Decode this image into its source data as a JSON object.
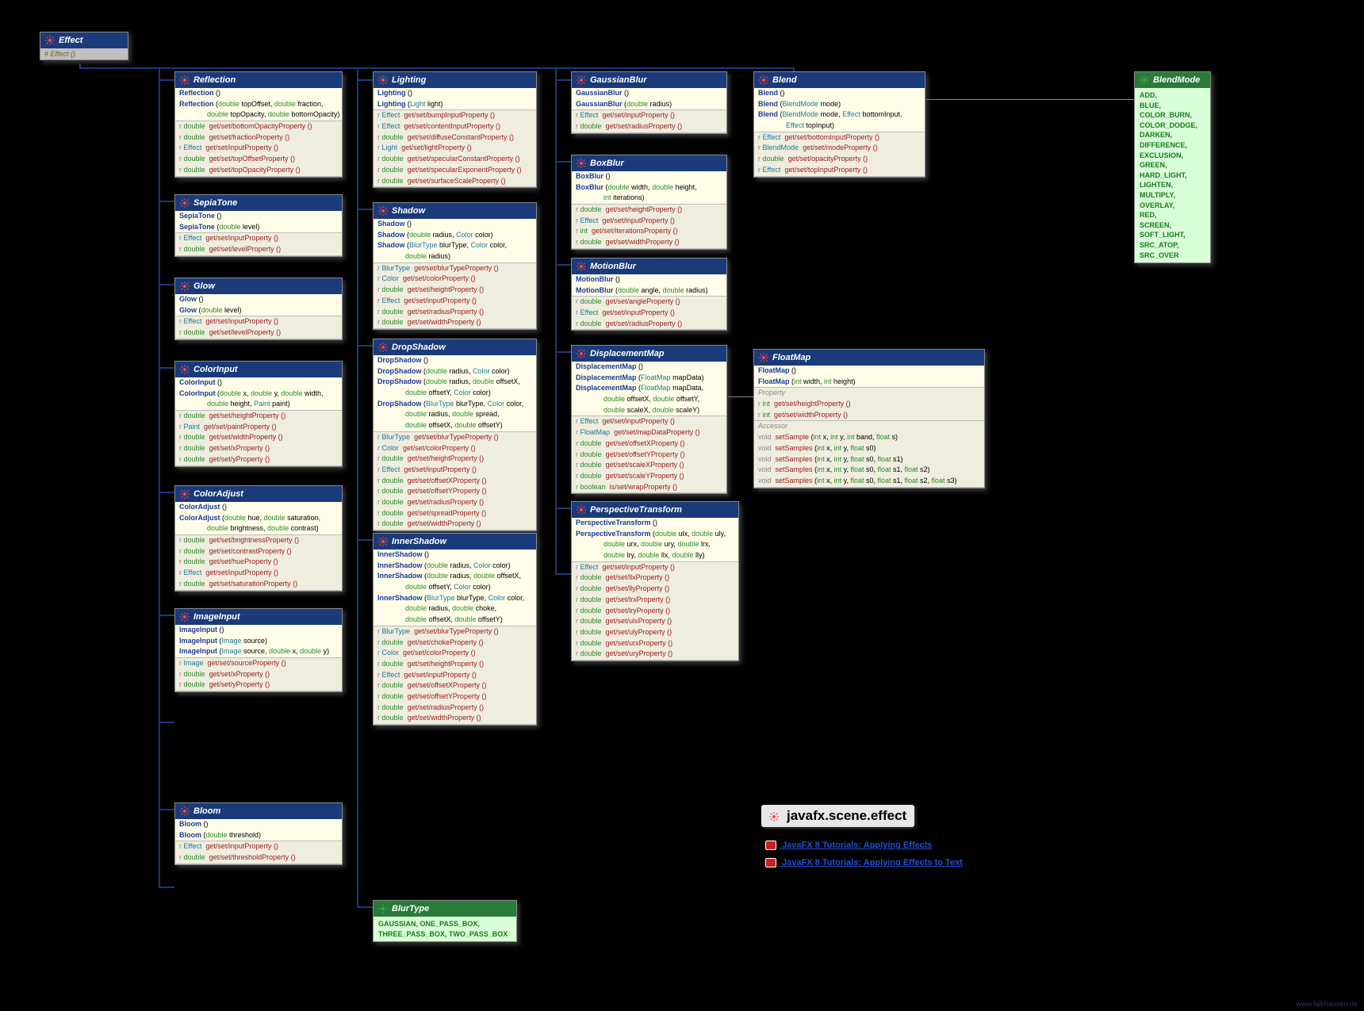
{
  "package_title": "javafx.scene.effect",
  "links": [
    "JavaFX 8 Tutorials: Applying Effects",
    "JavaFX 8 Tutorials: Applying Effects to Text"
  ],
  "watermark": "www.falkhausen.de",
  "root": {
    "title": "Effect",
    "sub": "# Effect ()"
  },
  "blendmode": {
    "title": "BlendMode",
    "items": [
      "ADD,",
      "BLUE,",
      "COLOR_BURN,",
      "COLOR_DODGE,",
      "DARKEN,",
      "DIFFERENCE,",
      "EXCLUSION,",
      "GREEN,",
      "HARD_LIGHT,",
      "LIGHTEN,",
      "MULTIPLY,",
      "OVERLAY,",
      "RED,",
      "SCREEN,",
      "SOFT_LIGHT,",
      "SRC_ATOP,",
      "SRC_OVER"
    ]
  },
  "blurtype": {
    "title": "BlurType",
    "line1": "GAUSSIAN, ONE_PASS_BOX,",
    "line2": "THREE_PASS_BOX, TWO_PASS_BOX"
  },
  "classes": {
    "reflection": {
      "title": "Reflection",
      "ctors": [
        {
          "name": "Reflection",
          "args": "()"
        },
        {
          "name": "Reflection",
          "args": "(double topOffset, double fraction,",
          "cont": "double topOpacity, double bottomOpacity)"
        }
      ],
      "props": [
        {
          "ret": "double",
          "m": "get/set/bottomOpacityProperty ()"
        },
        {
          "ret": "double",
          "m": "get/set/fractionProperty ()"
        },
        {
          "ret": "Effect",
          "m": "get/set/inputProperty ()"
        },
        {
          "ret": "double",
          "m": "get/set/topOffsetProperty ()"
        },
        {
          "ret": "double",
          "m": "get/set/topOpacityProperty ()"
        }
      ]
    },
    "sepiatone": {
      "title": "SepiaTone",
      "ctors": [
        {
          "name": "SepiaTone",
          "args": "()"
        },
        {
          "name": "SepiaTone",
          "args": "(double level)"
        }
      ],
      "props": [
        {
          "ret": "Effect",
          "m": "get/set/inputProperty ()"
        },
        {
          "ret": "double",
          "m": "get/set/levelProperty ()"
        }
      ]
    },
    "glow": {
      "title": "Glow",
      "ctors": [
        {
          "name": "Glow",
          "args": "()"
        },
        {
          "name": "Glow",
          "args": "(double level)"
        }
      ],
      "props": [
        {
          "ret": "Effect",
          "m": "get/set/inputProperty ()"
        },
        {
          "ret": "double",
          "m": "get/set/levelProperty ()"
        }
      ]
    },
    "colorinput": {
      "title": "ColorInput",
      "ctors": [
        {
          "name": "ColorInput",
          "args": "()"
        },
        {
          "name": "ColorInput",
          "args": "(double x, double y, double width,",
          "cont": "double height, Paint paint)"
        }
      ],
      "props": [
        {
          "ret": "double",
          "m": "get/set/heightProperty ()"
        },
        {
          "ret": "Paint",
          "m": "get/set/paintProperty ()"
        },
        {
          "ret": "double",
          "m": "get/set/widthProperty ()"
        },
        {
          "ret": "double",
          "m": "get/set/xProperty ()"
        },
        {
          "ret": "double",
          "m": "get/set/yProperty ()"
        }
      ]
    },
    "coloradjust": {
      "title": "ColorAdjust",
      "ctors": [
        {
          "name": "ColorAdjust",
          "args": "()"
        },
        {
          "name": "ColorAdjust",
          "args": "(double hue, double saturation,",
          "cont": "double brightness, double contrast)"
        }
      ],
      "props": [
        {
          "ret": "double",
          "m": "get/set/brightnessProperty ()"
        },
        {
          "ret": "double",
          "m": "get/set/contrastProperty ()"
        },
        {
          "ret": "double",
          "m": "get/set/hueProperty ()"
        },
        {
          "ret": "Effect",
          "m": "get/set/inputProperty ()"
        },
        {
          "ret": "double",
          "m": "get/set/saturationProperty ()"
        }
      ]
    },
    "imageinput": {
      "title": "ImageInput",
      "ctors": [
        {
          "name": "ImageInput",
          "args": "()"
        },
        {
          "name": "ImageInput",
          "args": "(Image source)"
        },
        {
          "name": "ImageInput",
          "args": "(Image source, double x, double y)"
        }
      ],
      "props": [
        {
          "ret": "Image",
          "m": "get/set/sourceProperty ()"
        },
        {
          "ret": "double",
          "m": "get/set/xProperty ()"
        },
        {
          "ret": "double",
          "m": "get/set/yProperty ()"
        }
      ]
    },
    "bloom": {
      "title": "Bloom",
      "ctors": [
        {
          "name": "Bloom",
          "args": "()"
        },
        {
          "name": "Bloom",
          "args": "(double threshold)"
        }
      ],
      "props": [
        {
          "ret": "Effect",
          "m": "get/set/inputProperty ()"
        },
        {
          "ret": "double",
          "m": "get/set/thresholdProperty ()"
        }
      ]
    },
    "lighting": {
      "title": "Lighting",
      "ctors": [
        {
          "name": "Lighting",
          "args": "()"
        },
        {
          "name": "Lighting",
          "args": "(Light light)"
        }
      ],
      "props": [
        {
          "ret": "Effect",
          "m": "get/set/bumpInputProperty ()"
        },
        {
          "ret": "Effect",
          "m": "get/set/contentInputProperty ()"
        },
        {
          "ret": "double",
          "m": "get/set/diffuseConstantProperty ()"
        },
        {
          "ret": "Light",
          "m": "get/set/lightProperty ()"
        },
        {
          "ret": "double",
          "m": "get/set/specularConstantProperty ()"
        },
        {
          "ret": "double",
          "m": "get/set/specularExponentProperty ()"
        },
        {
          "ret": "double",
          "m": "get/set/surfaceScaleProperty ()"
        }
      ]
    },
    "shadow": {
      "title": "Shadow",
      "ctors": [
        {
          "name": "Shadow",
          "args": "()"
        },
        {
          "name": "Shadow",
          "args": "(double radius, Color color)"
        },
        {
          "name": "Shadow",
          "args": "(BlurType blurType, Color color,",
          "cont": "double radius)"
        }
      ],
      "props": [
        {
          "ret": "BlurType",
          "m": "get/set/blurTypeProperty ()"
        },
        {
          "ret": "Color",
          "m": "get/set/colorProperty ()"
        },
        {
          "ret": "double",
          "m": "get/set/heightProperty ()"
        },
        {
          "ret": "Effect",
          "m": "get/set/inputProperty ()"
        },
        {
          "ret": "double",
          "m": "get/set/radiusProperty ()"
        },
        {
          "ret": "double",
          "m": "get/set/widthProperty ()"
        }
      ]
    },
    "dropshadow": {
      "title": "DropShadow",
      "ctors": [
        {
          "name": "DropShadow",
          "args": "()"
        },
        {
          "name": "DropShadow",
          "args": "(double radius, Color color)"
        },
        {
          "name": "DropShadow",
          "args": "(double radius, double offsetX,",
          "cont": "double offsetY, Color color)"
        },
        {
          "name": "DropShadow",
          "args": "(BlurType blurType, Color color,",
          "cont": "double radius, double spread,",
          "cont2": "double offsetX, double offsetY)"
        }
      ],
      "props": [
        {
          "ret": "BlurType",
          "m": "get/set/blurTypeProperty ()"
        },
        {
          "ret": "Color",
          "m": "get/set/colorProperty ()"
        },
        {
          "ret": "double",
          "m": "get/set/heightProperty ()"
        },
        {
          "ret": "Effect",
          "m": "get/set/inputProperty ()"
        },
        {
          "ret": "double",
          "m": "get/set/offsetXProperty ()"
        },
        {
          "ret": "double",
          "m": "get/set/offsetYProperty ()"
        },
        {
          "ret": "double",
          "m": "get/set/radiusProperty ()"
        },
        {
          "ret": "double",
          "m": "get/set/spreadProperty ()"
        },
        {
          "ret": "double",
          "m": "get/set/widthProperty ()"
        }
      ]
    },
    "innershadow": {
      "title": "InnerShadow",
      "ctors": [
        {
          "name": "InnerShadow",
          "args": "()"
        },
        {
          "name": "InnerShadow",
          "args": "(double radius, Color color)"
        },
        {
          "name": "InnerShadow",
          "args": "(double radius, double offsetX,",
          "cont": "double offsetY, Color color)"
        },
        {
          "name": "InnerShadow",
          "args": "(BlurType blurType, Color color,",
          "cont": "double radius, double choke,",
          "cont2": "double offsetX, double offsetY)"
        }
      ],
      "props": [
        {
          "ret": "BlurType",
          "m": "get/set/blurTypeProperty ()"
        },
        {
          "ret": "double",
          "m": "get/set/chokeProperty ()"
        },
        {
          "ret": "Color",
          "m": "get/set/colorProperty ()"
        },
        {
          "ret": "double",
          "m": "get/set/heightProperty ()"
        },
        {
          "ret": "Effect",
          "m": "get/set/inputProperty ()"
        },
        {
          "ret": "double",
          "m": "get/set/offsetXProperty ()"
        },
        {
          "ret": "double",
          "m": "get/set/offsetYProperty ()"
        },
        {
          "ret": "double",
          "m": "get/set/radiusProperty ()"
        },
        {
          "ret": "double",
          "m": "get/set/widthProperty ()"
        }
      ]
    },
    "gaussianblur": {
      "title": "GaussianBlur",
      "ctors": [
        {
          "name": "GaussianBlur",
          "args": "()"
        },
        {
          "name": "GaussianBlur",
          "args": "(double radius)"
        }
      ],
      "props": [
        {
          "ret": "Effect",
          "m": "get/set/inputProperty ()"
        },
        {
          "ret": "double",
          "m": "get/set/radiusProperty ()"
        }
      ]
    },
    "boxblur": {
      "title": "BoxBlur",
      "ctors": [
        {
          "name": "BoxBlur",
          "args": "()"
        },
        {
          "name": "BoxBlur",
          "args": "(double width, double height,",
          "cont": "int iterations)"
        }
      ],
      "props": [
        {
          "ret": "double",
          "m": "get/set/heightProperty ()"
        },
        {
          "ret": "Effect",
          "m": "get/set/inputProperty ()"
        },
        {
          "ret": "int",
          "m": "get/set/iterationsProperty ()"
        },
        {
          "ret": "double",
          "m": "get/set/widthProperty ()"
        }
      ]
    },
    "motionblur": {
      "title": "MotionBlur",
      "ctors": [
        {
          "name": "MotionBlur",
          "args": "()"
        },
        {
          "name": "MotionBlur",
          "args": "(double angle, double radius)"
        }
      ],
      "props": [
        {
          "ret": "double",
          "m": "get/set/angleProperty ()"
        },
        {
          "ret": "Effect",
          "m": "get/set/inputProperty ()"
        },
        {
          "ret": "double",
          "m": "get/set/radiusProperty ()"
        }
      ]
    },
    "displacementmap": {
      "title": "DisplacementMap",
      "ctors": [
        {
          "name": "DisplacementMap",
          "args": "()"
        },
        {
          "name": "DisplacementMap",
          "args": "(FloatMap mapData)"
        },
        {
          "name": "DisplacementMap",
          "args": "(FloatMap mapData,",
          "cont": "double offsetX, double offsetY,",
          "cont2": "double scaleX, double scaleY)"
        }
      ],
      "props": [
        {
          "ret": "Effect",
          "m": "get/set/inputProperty ()"
        },
        {
          "ret": "FloatMap",
          "m": "get/set/mapDataProperty ()"
        },
        {
          "ret": "double",
          "m": "get/set/offsetXProperty ()"
        },
        {
          "ret": "double",
          "m": "get/set/offsetYProperty ()"
        },
        {
          "ret": "double",
          "m": "get/set/scaleXProperty ()"
        },
        {
          "ret": "double",
          "m": "get/set/scaleYProperty ()"
        },
        {
          "ret": "boolean",
          "m": "is/set/wrapProperty ()"
        }
      ]
    },
    "perspectivetransform": {
      "title": "PerspectiveTransform",
      "ctors": [
        {
          "name": "PerspectiveTransform",
          "args": "()"
        },
        {
          "name": "PerspectiveTransform",
          "args": "(double ulx, double uly,",
          "cont": "double urx, double ury, double lrx,",
          "cont2": "double lry, double llx, double lly)"
        }
      ],
      "props": [
        {
          "ret": "Effect",
          "m": "get/set/inputProperty ()"
        },
        {
          "ret": "double",
          "m": "get/set/llxProperty ()"
        },
        {
          "ret": "double",
          "m": "get/set/llyProperty ()"
        },
        {
          "ret": "double",
          "m": "get/set/lrxProperty ()"
        },
        {
          "ret": "double",
          "m": "get/set/lryProperty ()"
        },
        {
          "ret": "double",
          "m": "get/set/ulxProperty ()"
        },
        {
          "ret": "double",
          "m": "get/set/ulyProperty ()"
        },
        {
          "ret": "double",
          "m": "get/set/urxProperty ()"
        },
        {
          "ret": "double",
          "m": "get/set/uryProperty ()"
        }
      ]
    },
    "blend": {
      "title": "Blend",
      "ctors": [
        {
          "name": "Blend",
          "args": "()"
        },
        {
          "name": "Blend",
          "args": "(BlendMode mode)"
        },
        {
          "name": "Blend",
          "args": "(BlendMode mode, Effect bottomInput,",
          "cont": "Effect topInput)"
        }
      ],
      "props": [
        {
          "ret": "Effect",
          "m": "get/set/bottomInputProperty ()"
        },
        {
          "ret": "BlendMode",
          "m": "get/set/modeProperty ()"
        },
        {
          "ret": "double",
          "m": "get/set/opacityProperty ()"
        },
        {
          "ret": "Effect",
          "m": "get/set/topInputProperty ()"
        }
      ]
    },
    "floatmap": {
      "title": "FloatMap",
      "ctors": [
        {
          "name": "FloatMap",
          "args": "()"
        },
        {
          "name": "FloatMap",
          "args": "(int width, int height)"
        }
      ],
      "prop_section_label": "Property",
      "props": [
        {
          "ret": "int",
          "m": "get/set/heightProperty ()"
        },
        {
          "ret": "int",
          "m": "get/set/widthProperty ()"
        }
      ],
      "acc_section_label": "Accessor",
      "accessors": [
        {
          "ret": "void",
          "m": "setSample (int x, int y, int band, float s)"
        },
        {
          "ret": "void",
          "m": "setSamples (int x, int y, float s0)"
        },
        {
          "ret": "void",
          "m": "setSamples (int x, int y, float s0, float s1)"
        },
        {
          "ret": "void",
          "m": "setSamples (int x, int y, float s0, float s1, float s2)"
        },
        {
          "ret": "void",
          "m": "setSamples (int x, int y, float s0, float s1, float s2, float s3)"
        }
      ]
    }
  }
}
